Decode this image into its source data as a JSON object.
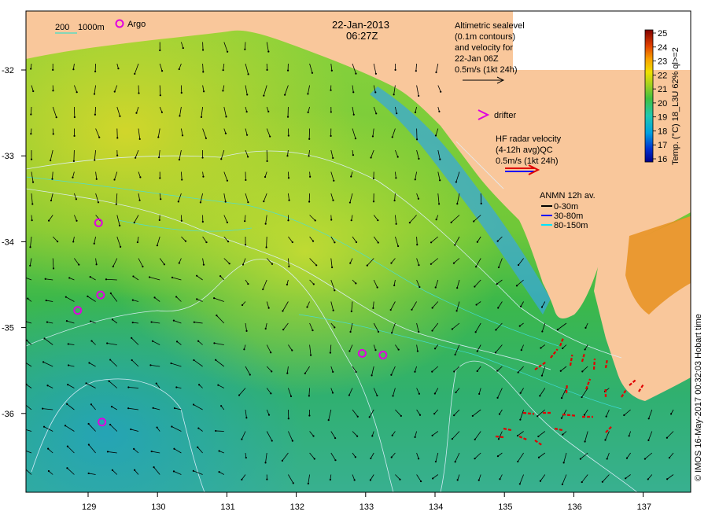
{
  "header": {
    "date": "22-Jan-2013",
    "time": "06:27Z"
  },
  "scale_legend": {
    "depth_label": "200",
    "depth_label2": "1000m",
    "argo_label": "Argo"
  },
  "altimetry_note": {
    "lines": [
      "Altimetric sealevel",
      "(0.1m contours)",
      "and velocity for",
      "22-Jan 06Z",
      "0.5m/s (1kt 24h)"
    ]
  },
  "drifter_note": {
    "label": "drifter"
  },
  "hf_radar_note": {
    "lines": [
      "HF radar velocity",
      "(4-12h avg)QC",
      "0.5m/s (1kt 24h)"
    ]
  },
  "anmn_note": {
    "title": "ANMN 12h av.",
    "items": [
      {
        "label": "0-30m",
        "color": "#000000"
      },
      {
        "label": "30-80m",
        "color": "#0000ff"
      },
      {
        "label": "80-150m",
        "color": "#00e5ff"
      }
    ]
  },
  "colorbar": {
    "title": "Temp. (°C) 18_L3U 62% ql>=2",
    "min": 16,
    "max": 25,
    "ticks": [
      "25",
      "24",
      "23",
      "22",
      "21",
      "20",
      "19",
      "18",
      "17",
      "16"
    ]
  },
  "credit": "© IMOS 16-May-2017 00:32:03 Hobart time",
  "axes": {
    "lon_ticks": [
      "129",
      "130",
      "131",
      "132",
      "133",
      "134",
      "135",
      "136",
      "137"
    ],
    "lat_ticks": [
      "-32",
      "-33",
      "-34",
      "-35",
      "-36"
    ]
  },
  "argo_floats": [
    {
      "lon": 129.15,
      "lat": -33.78
    },
    {
      "lon": 129.18,
      "lat": -34.62
    },
    {
      "lon": 128.85,
      "lat": -34.8
    },
    {
      "lon": 129.2,
      "lat": -36.1
    },
    {
      "lon": 132.95,
      "lat": -35.3
    },
    {
      "lon": 133.25,
      "lat": -35.32
    }
  ],
  "colors": {
    "land": "#f9c79b",
    "arrow": "#000000",
    "hf_radar": "#e00000",
    "argo": "#e000e0"
  }
}
